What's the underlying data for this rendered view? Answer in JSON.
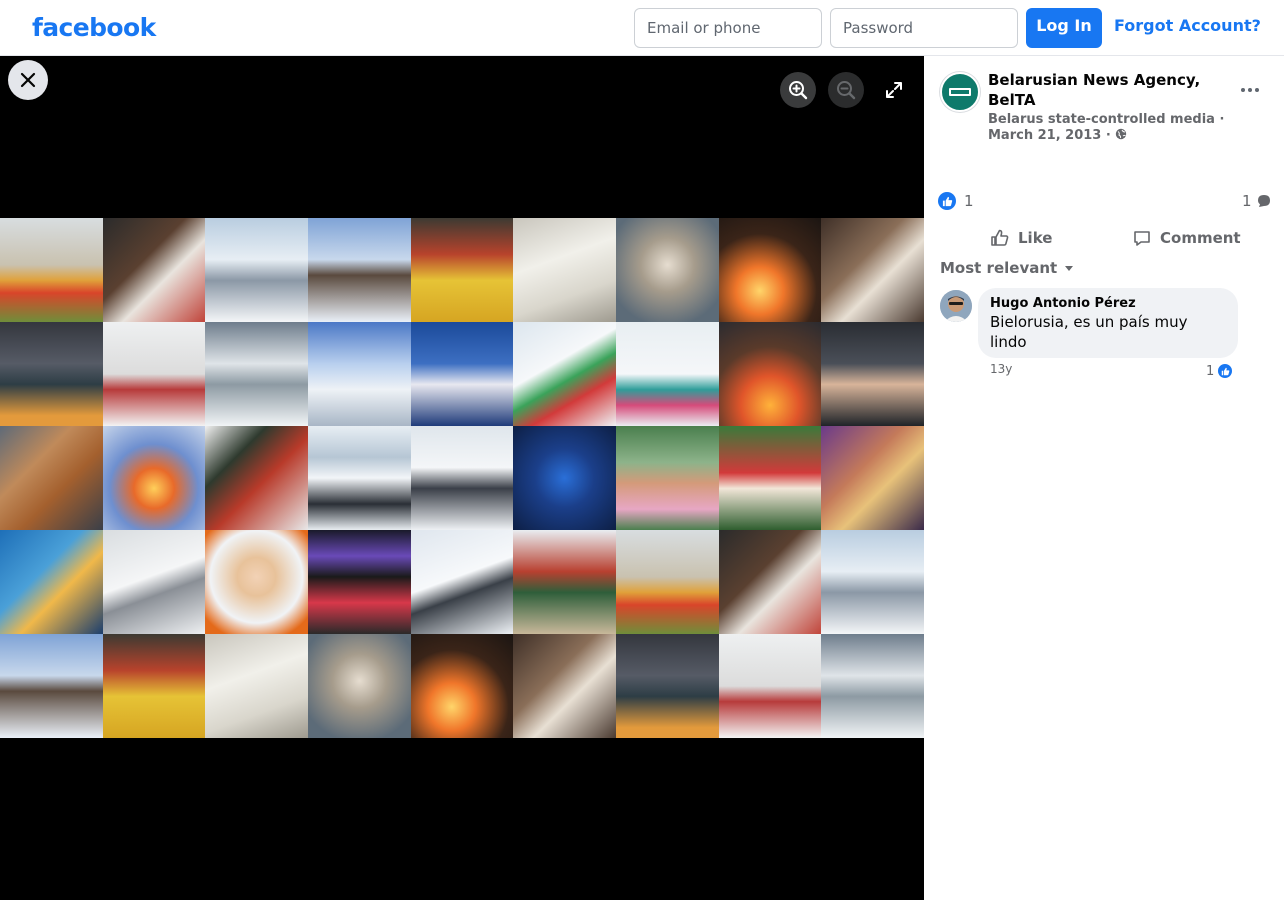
{
  "header": {
    "logo": "facebook",
    "email_placeholder": "Email or phone",
    "password_placeholder": "Password",
    "login_label": "Log In",
    "forgot_label": "Forgot Account?"
  },
  "viewer": {
    "icons": [
      "close-icon",
      "zoom-in-icon",
      "zoom-out-icon",
      "fullscreen-icon"
    ]
  },
  "post": {
    "author": "Belarusian News Agency, BelTA",
    "label": "Belarus state-controlled media",
    "separator": "·",
    "date": "March 21, 2013",
    "reaction_count": "1",
    "comment_count": "1",
    "like_label": "Like",
    "comment_label": "Comment",
    "sort_label": "Most relevant"
  },
  "comments": [
    {
      "author": "Hugo Antonio Pérez",
      "text": "Bielorusia, es un país muy lindo",
      "time": "13y",
      "likes": "1"
    }
  ],
  "colors": {
    "brand": "#1877f2",
    "viewer_bg": "#000000",
    "muted_text": "#65676b"
  }
}
